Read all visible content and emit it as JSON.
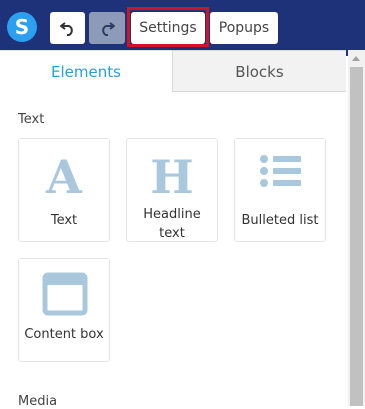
{
  "toolbar": {
    "logo_letter": "S",
    "settings_label": "Settings",
    "popups_label": "Popups"
  },
  "tabs": [
    {
      "label": "Elements",
      "active": true
    },
    {
      "label": "Blocks",
      "active": false
    }
  ],
  "sections": {
    "text_title": "Text",
    "media_title": "Media"
  },
  "elements": [
    {
      "label": "Text",
      "icon": "letter-a-icon"
    },
    {
      "label": "Headline text",
      "icon": "letter-h-icon"
    },
    {
      "label": "Bulleted list",
      "icon": "bulleted-list-icon"
    },
    {
      "label": "Content box",
      "icon": "content-box-icon"
    }
  ],
  "colors": {
    "topbar": "#1d3278",
    "accent": "#2aa0d8",
    "icon": "#a9c8dd",
    "highlight": "#d0122a"
  }
}
